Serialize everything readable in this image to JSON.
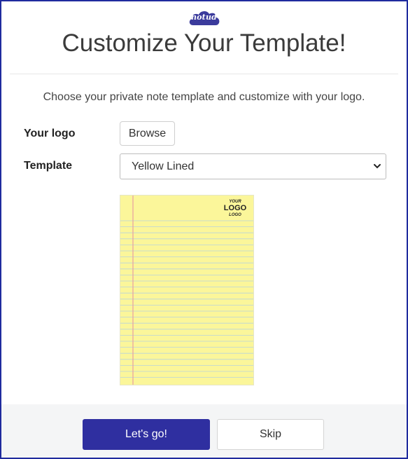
{
  "brand": {
    "logo_text": "notud",
    "color": "#3b3b9c"
  },
  "header": {
    "title": "Customize Your Template!"
  },
  "main": {
    "subtitle": "Choose your private note template and customize with your logo.",
    "logo_field": {
      "label": "Your logo",
      "button_label": "Browse"
    },
    "template_field": {
      "label": "Template",
      "selected": "Yellow Lined",
      "icon": "chevron-down-icon"
    },
    "preview": {
      "logo_top": "YOUR",
      "logo_main": "LOGO",
      "logo_bottom": "LOGO",
      "paper_color": "#fbf69a"
    }
  },
  "footer": {
    "primary_label": "Let's go!",
    "secondary_label": "Skip",
    "primary_color": "#2f2fa0"
  }
}
